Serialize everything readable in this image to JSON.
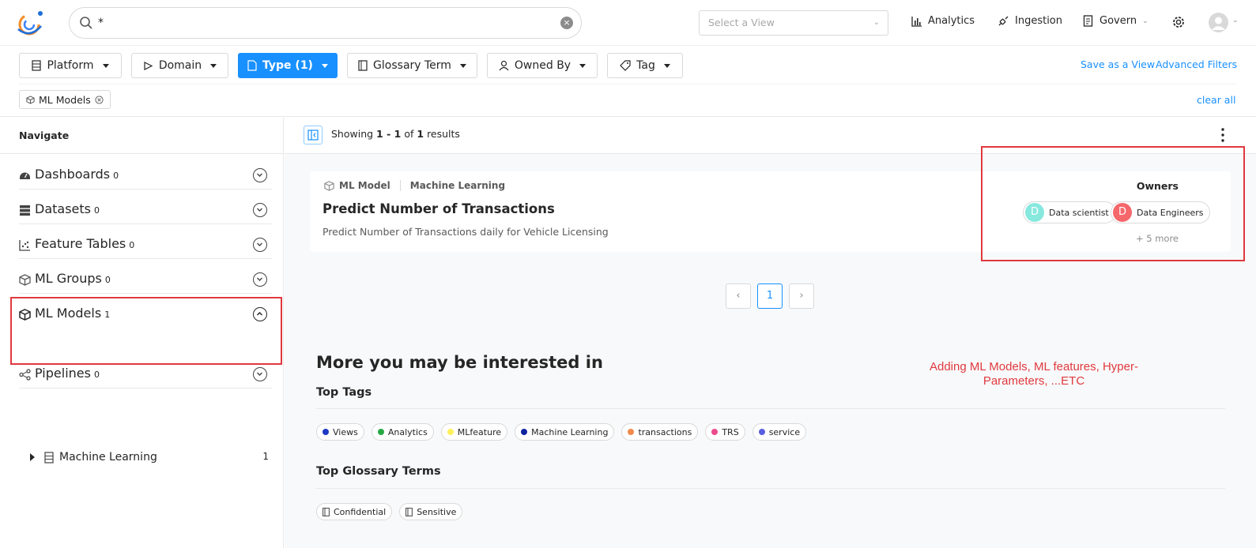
{
  "header": {
    "search_value": "*",
    "view_placeholder": "Select a View",
    "nav": [
      {
        "label": "Analytics",
        "icon": "bar-chart-icon"
      },
      {
        "label": "Ingestion",
        "icon": "api-plug-icon"
      },
      {
        "label": "Govern",
        "icon": "document-icon"
      }
    ]
  },
  "filters": {
    "buttons": [
      {
        "label": "Platform",
        "icon": "database-icon"
      },
      {
        "label": "Domain",
        "icon": "domain-icon"
      },
      {
        "label": "Type (1)",
        "icon": "file-icon"
      },
      {
        "label": "Glossary Term",
        "icon": "book-icon"
      },
      {
        "label": "Owned By",
        "icon": "user-icon"
      },
      {
        "label": "Tag",
        "icon": "tag-icon"
      }
    ],
    "save_view": "Save as a View",
    "advanced": "Advanced Filters",
    "active_chip": "ML Models",
    "clear_all": "clear all"
  },
  "sidebar": {
    "title": "Navigate",
    "items": [
      {
        "label": "Dashboards",
        "count": "0"
      },
      {
        "label": "Datasets",
        "count": "0"
      },
      {
        "label": "Feature Tables",
        "count": "0"
      },
      {
        "label": "ML Groups",
        "count": "0"
      },
      {
        "label": "ML Models",
        "count": "1"
      },
      {
        "label": "Pipelines",
        "count": "0"
      }
    ],
    "sub_item": {
      "label": "Machine Learning",
      "count": "1"
    }
  },
  "results": {
    "prefix": "Showing",
    "range": "1 - 1",
    "of": "of",
    "total": "1",
    "suffix": "results"
  },
  "card": {
    "entity_type": "ML Model",
    "platform": "Machine Learning",
    "title": "Predict Number of Transactions",
    "description": "Predict Number of Transactions daily for Vehicle Licensing",
    "owners_label": "Owners",
    "owners": [
      {
        "initial": "D",
        "name": "Data scientist",
        "color": "#87e8de"
      },
      {
        "initial": "D",
        "name": "Data Engineers",
        "color": "#f5676b"
      }
    ],
    "more_owners": "+ 5 more"
  },
  "pagination": {
    "current": "1"
  },
  "recommendations": {
    "title": "More you may be interested in",
    "annotation": "Adding ML Models, ML features, Hyper-Parameters, ...ETC",
    "top_tags_title": "Top Tags",
    "tags": [
      {
        "label": "Views",
        "color": "#1d39c4"
      },
      {
        "label": "Analytics",
        "color": "#27a845"
      },
      {
        "label": "MLfeature",
        "color": "#ffef5c"
      },
      {
        "label": "Machine Learning",
        "color": "#10239e"
      },
      {
        "label": "transactions",
        "color": "#f08a4b"
      },
      {
        "label": "TRS",
        "color": "#eb4c8b"
      },
      {
        "label": "service",
        "color": "#5a5fe0"
      }
    ],
    "glossary_title": "Top Glossary Terms",
    "glossary": [
      {
        "label": "Confidential"
      },
      {
        "label": "Sensitive"
      }
    ]
  }
}
